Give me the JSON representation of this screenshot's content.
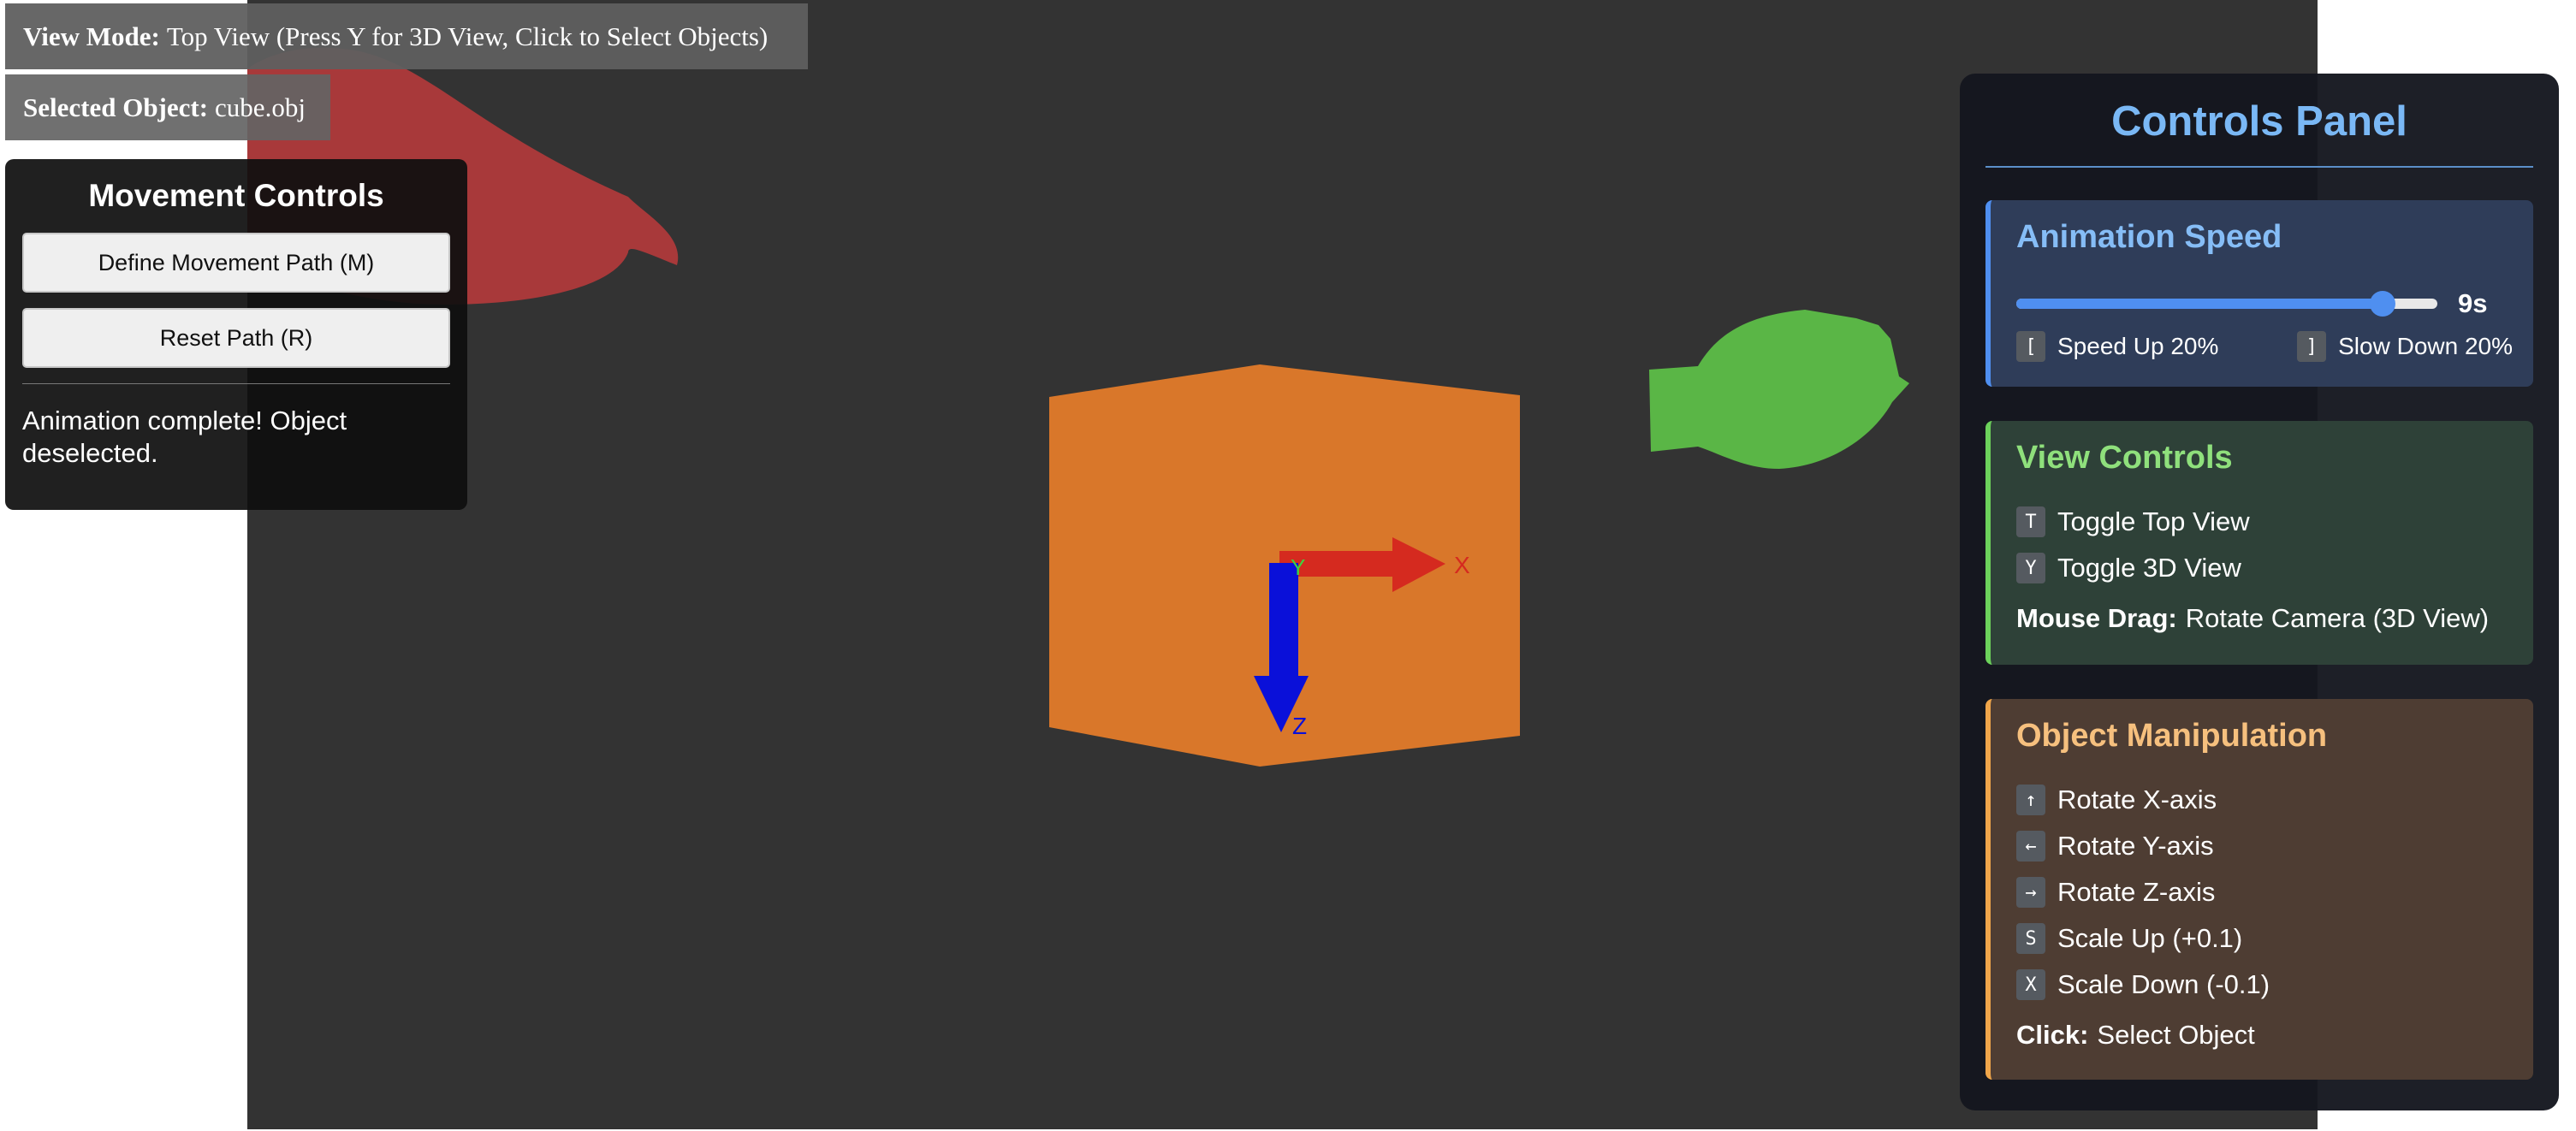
{
  "view_mode": {
    "label": "View Mode:",
    "value": "Top View (Press Y for 3D View, Click to Select Objects)"
  },
  "selected_object": {
    "label": "Selected Object:",
    "value": "cube.obj"
  },
  "movement_controls": {
    "title": "Movement Controls",
    "define_path_button": "Define Movement Path (M)",
    "reset_path_button": "Reset Path (R)",
    "status": "Animation complete! Object deselected."
  },
  "scene": {
    "axis_labels": {
      "x": "X",
      "y": "Y",
      "z": "Z"
    },
    "colors": {
      "background": "#333333",
      "cube": "#d9772a",
      "red_object": "#a8393a",
      "green_object": "#5ab646",
      "axis_x": "#d52a1f",
      "axis_y": "#3fd33f",
      "axis_z": "#0a10d9"
    }
  },
  "controls_panel": {
    "title": "Controls Panel",
    "animation_speed": {
      "title": "Animation Speed",
      "value_label": "9s",
      "slider_fraction": 0.87,
      "speed_up_key": "[",
      "speed_up_label": "Speed Up 20%",
      "slow_down_key": "]",
      "slow_down_label": "Slow Down 20%"
    },
    "view_controls": {
      "title": "View Controls",
      "items": [
        {
          "key": "T",
          "label": "Toggle Top View"
        },
        {
          "key": "Y",
          "label": "Toggle 3D View"
        }
      ],
      "note_label": "Mouse Drag:",
      "note_value": "Rotate Camera (3D View)"
    },
    "object_manipulation": {
      "title": "Object Manipulation",
      "items": [
        {
          "key": "↑",
          "label": "Rotate X-axis"
        },
        {
          "key": "←",
          "label": "Rotate Y-axis"
        },
        {
          "key": "→",
          "label": "Rotate Z-axis"
        },
        {
          "key": "S",
          "label": "Scale Up (+0.1)"
        },
        {
          "key": "X",
          "label": "Scale Down (-0.1)"
        }
      ],
      "note_label": "Click:",
      "note_value": "Select Object"
    }
  }
}
